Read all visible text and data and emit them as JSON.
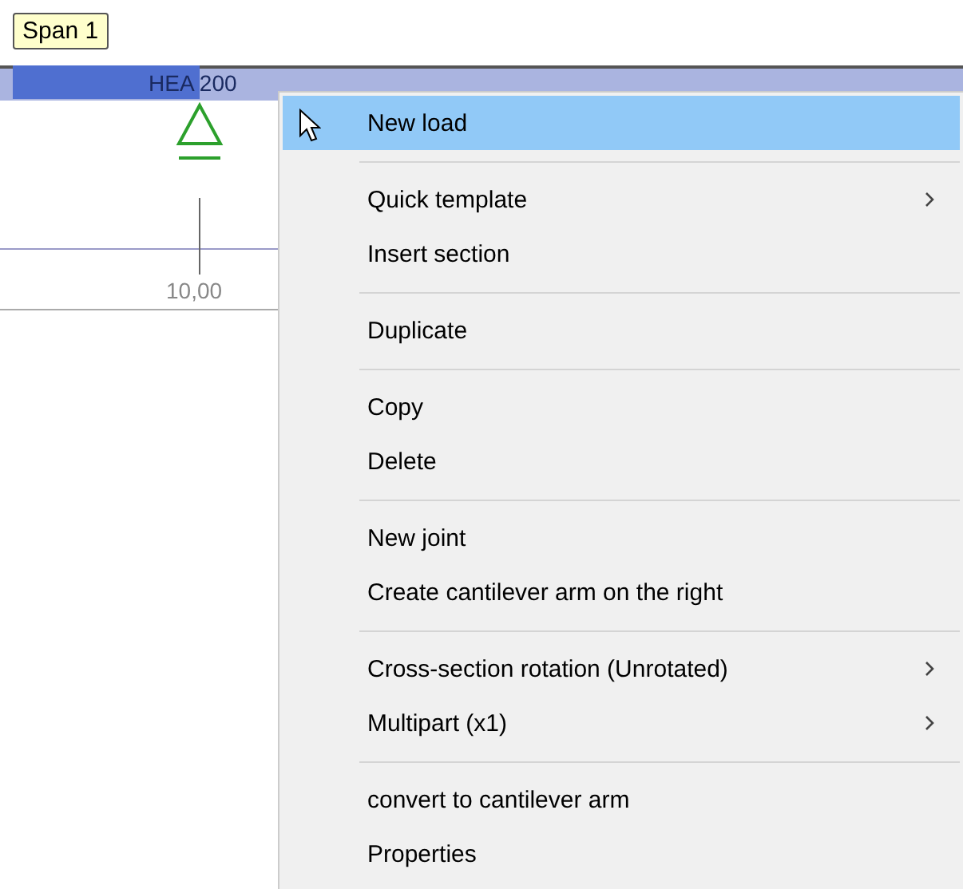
{
  "canvas": {
    "tooltip": "Span 1",
    "beam_label": "HEA 200",
    "dimension": "10,00"
  },
  "context_menu": {
    "items": [
      {
        "kind": "item",
        "label": "New load",
        "selected": true,
        "submenu": false
      },
      {
        "kind": "separator"
      },
      {
        "kind": "item",
        "label": "Quick template",
        "selected": false,
        "submenu": true
      },
      {
        "kind": "item",
        "label": "Insert section",
        "selected": false,
        "submenu": false
      },
      {
        "kind": "separator"
      },
      {
        "kind": "item",
        "label": "Duplicate",
        "selected": false,
        "submenu": false
      },
      {
        "kind": "separator"
      },
      {
        "kind": "item",
        "label": "Copy",
        "selected": false,
        "submenu": false
      },
      {
        "kind": "item",
        "label": "Delete",
        "selected": false,
        "submenu": false
      },
      {
        "kind": "separator"
      },
      {
        "kind": "item",
        "label": "New joint",
        "selected": false,
        "submenu": false
      },
      {
        "kind": "item",
        "label": "Create cantilever arm on the right",
        "selected": false,
        "submenu": false
      },
      {
        "kind": "separator"
      },
      {
        "kind": "item",
        "label": "Cross-section rotation (Unrotated)",
        "selected": false,
        "submenu": true
      },
      {
        "kind": "item",
        "label": "Multipart (x1)",
        "selected": false,
        "submenu": true
      },
      {
        "kind": "separator"
      },
      {
        "kind": "item",
        "label": "convert to cantilever arm",
        "selected": false,
        "submenu": false
      },
      {
        "kind": "item",
        "label": "Properties",
        "selected": false,
        "submenu": false
      }
    ]
  }
}
